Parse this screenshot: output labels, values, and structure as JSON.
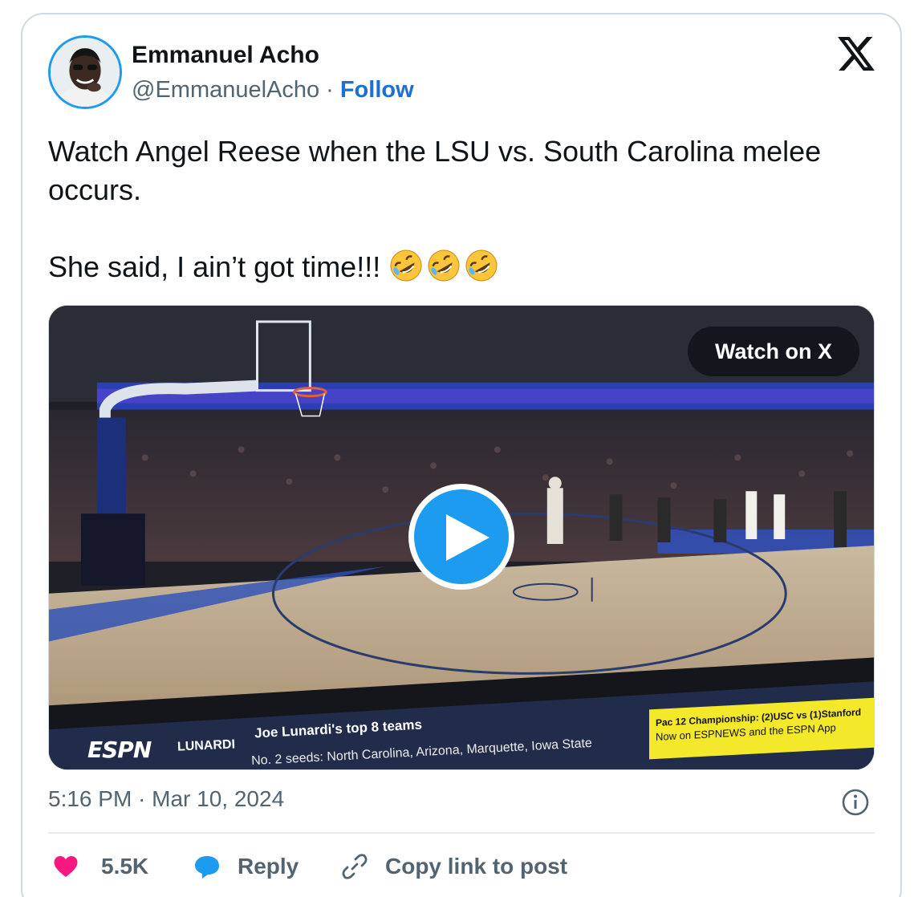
{
  "author": {
    "name": "Emmanuel Acho",
    "handle": "@EmmanuelAcho",
    "separator": "·",
    "follow_label": "Follow"
  },
  "tweet": {
    "line1": "Watch Angel Reese when the LSU vs. South Carolina melee occurs.",
    "line2": "She said, I ain’t got time!!!",
    "emojis": [
      "rolling-on-floor-laughing-emoji",
      "rolling-on-floor-laughing-emoji",
      "rolling-on-floor-laughing-emoji"
    ]
  },
  "media": {
    "watch_label": "Watch on X",
    "ticker": {
      "network": "ESPN",
      "segment": "LUNARDI",
      "headline": "Joe Lunardi's top 8 teams",
      "subline": "No. 2 seeds: North Carolina, Arizona, Marquette, Iowa State",
      "promo_line1": "Pac 12 Championship: (2)USC vs (1)Stanford",
      "promo_line2": "Now on ESPNEWS and the ESPN App"
    }
  },
  "timestamp": "5:16 PM · Mar 10, 2024",
  "actions": {
    "like_count": "5.5K",
    "reply_label": "Reply",
    "copy_label": "Copy link to post"
  },
  "colors": {
    "accent": "#1d9bf0",
    "follow": "#1d6fd1",
    "like": "#f91880",
    "muted": "#536471",
    "promo": "#f4e82a"
  }
}
